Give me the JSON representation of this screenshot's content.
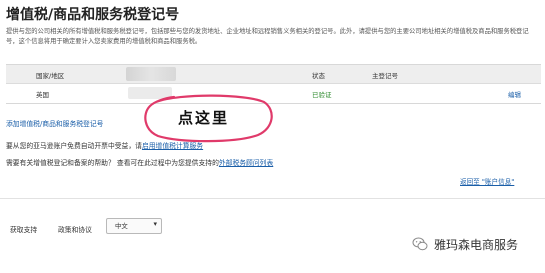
{
  "header": {
    "title": "增值税/商品和服务税登记号",
    "description": "提供与您的公司相关的所有增值税和服务税登记号，包括那些与您的发货地址、企业地址和远程销售义务相关的登记号。此外，请提供与您的主要公司地址相关的增值税及商品和服务税登记号，这个信息将用于确定要计入您卖家费用的增值税和商品和服务税。"
  },
  "table": {
    "headers": {
      "country": "国家/地区",
      "status": "状态",
      "reg": "主登记号"
    },
    "rows": [
      {
        "country": "英国",
        "status": "已验证",
        "action": "编辑"
      }
    ]
  },
  "links": {
    "add_reg": "添加增值税/商品和服务税登记号",
    "line1_prefix": "要从您的亚马逊账户免费自动开票中受益，请",
    "line1_link": "启用增值税计算服务",
    "line2_prefix": "需要有关增值税登记和备案的帮助？ 查看可在此过程中为您提供支持的",
    "line2_link": "外部税务顾问列表",
    "return": "返回至 \"账户信息\""
  },
  "annotation": {
    "text": "点这里",
    "color": "#e03a6a"
  },
  "footer": {
    "support": "获取支持",
    "policy": "政策和协议",
    "language": "中文"
  },
  "watermark": {
    "text": "雅玛森电商服务"
  },
  "icons": {
    "dropdown": "chevron-down-icon",
    "watermark": "wechat-icon"
  }
}
